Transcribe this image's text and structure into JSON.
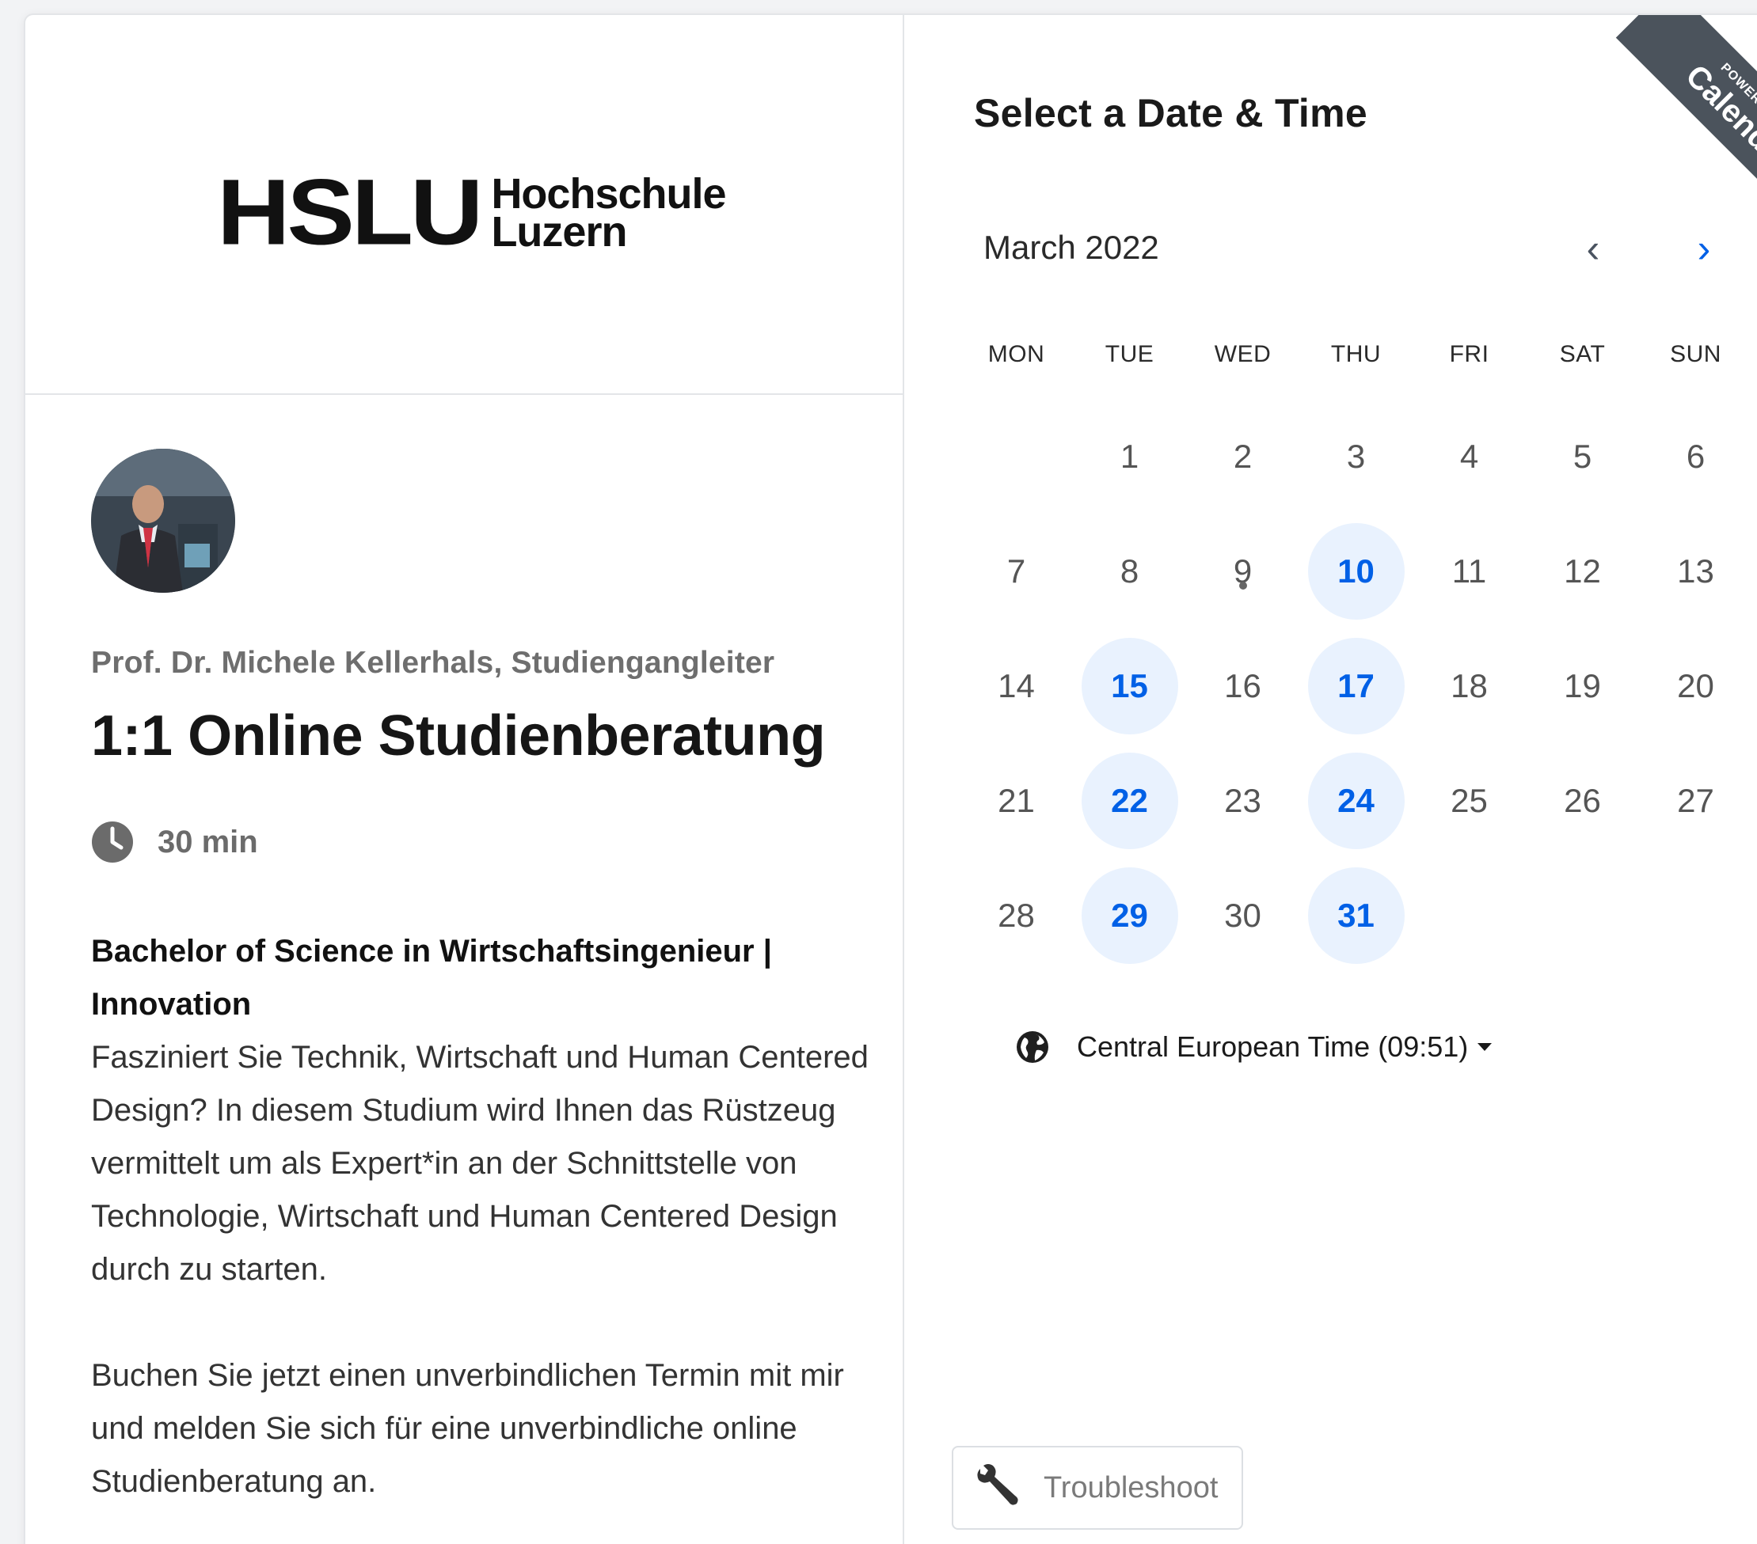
{
  "logo": {
    "mark": "HSLU",
    "line1": "Hochschule",
    "line2": "Luzern"
  },
  "host": {
    "name": "Prof. Dr. Michele Kellerhals, Studiengangleiter"
  },
  "event": {
    "title": "1:1 Online Studienberatung",
    "duration": "30 min",
    "description": {
      "heading": "Bachelor of Science in Wirtschaftsingenieur | Innovation",
      "paragraph1": "Fasziniert Sie Technik, Wirtschaft und Human Centered Design? In diesem Studium wird Ihnen das Rüstzeug vermittelt um als Expert*in an der Schnittstelle von Technologie, Wirtschaft und Human Centered Design durch zu starten.",
      "paragraph2": "Buchen Sie jetzt einen unverbindlichen Termin mit mir und melden Sie sich für eine unverbindliche online Studienberatung an."
    }
  },
  "calendar": {
    "section_title": "Select a Date & Time",
    "month_label": "March 2022",
    "prev_icon": "‹",
    "next_icon": "›",
    "weekdays": [
      "MON",
      "TUE",
      "WED",
      "THU",
      "FRI",
      "SAT",
      "SUN"
    ],
    "leading_blanks": 1,
    "today": 9,
    "days": [
      {
        "day": "1",
        "available": false
      },
      {
        "day": "2",
        "available": false
      },
      {
        "day": "3",
        "available": false
      },
      {
        "day": "4",
        "available": false
      },
      {
        "day": "5",
        "available": false
      },
      {
        "day": "6",
        "available": false
      },
      {
        "day": "7",
        "available": false
      },
      {
        "day": "8",
        "available": false
      },
      {
        "day": "9",
        "available": false
      },
      {
        "day": "10",
        "available": true
      },
      {
        "day": "11",
        "available": false
      },
      {
        "day": "12",
        "available": false
      },
      {
        "day": "13",
        "available": false
      },
      {
        "day": "14",
        "available": false
      },
      {
        "day": "15",
        "available": true
      },
      {
        "day": "16",
        "available": false
      },
      {
        "day": "17",
        "available": true
      },
      {
        "day": "18",
        "available": false
      },
      {
        "day": "19",
        "available": false
      },
      {
        "day": "20",
        "available": false
      },
      {
        "day": "21",
        "available": false
      },
      {
        "day": "22",
        "available": true
      },
      {
        "day": "23",
        "available": false
      },
      {
        "day": "24",
        "available": true
      },
      {
        "day": "25",
        "available": false
      },
      {
        "day": "26",
        "available": false
      },
      {
        "day": "27",
        "available": false
      },
      {
        "day": "28",
        "available": false
      },
      {
        "day": "29",
        "available": true
      },
      {
        "day": "30",
        "available": false
      },
      {
        "day": "31",
        "available": true
      }
    ]
  },
  "timezone": {
    "label": "Central European Time (09:51)",
    "icon": "globe-icon"
  },
  "troubleshoot": {
    "label": "Troubleshoot",
    "icon": "wrench-icon"
  },
  "ribbon": {
    "small": "POWERED BY",
    "big": "Calendly"
  },
  "colors": {
    "accent": "#0060e6",
    "available_bg": "#e9f2fe",
    "ribbon_bg": "#4b535c",
    "muted_text": "#6e6e6e"
  }
}
